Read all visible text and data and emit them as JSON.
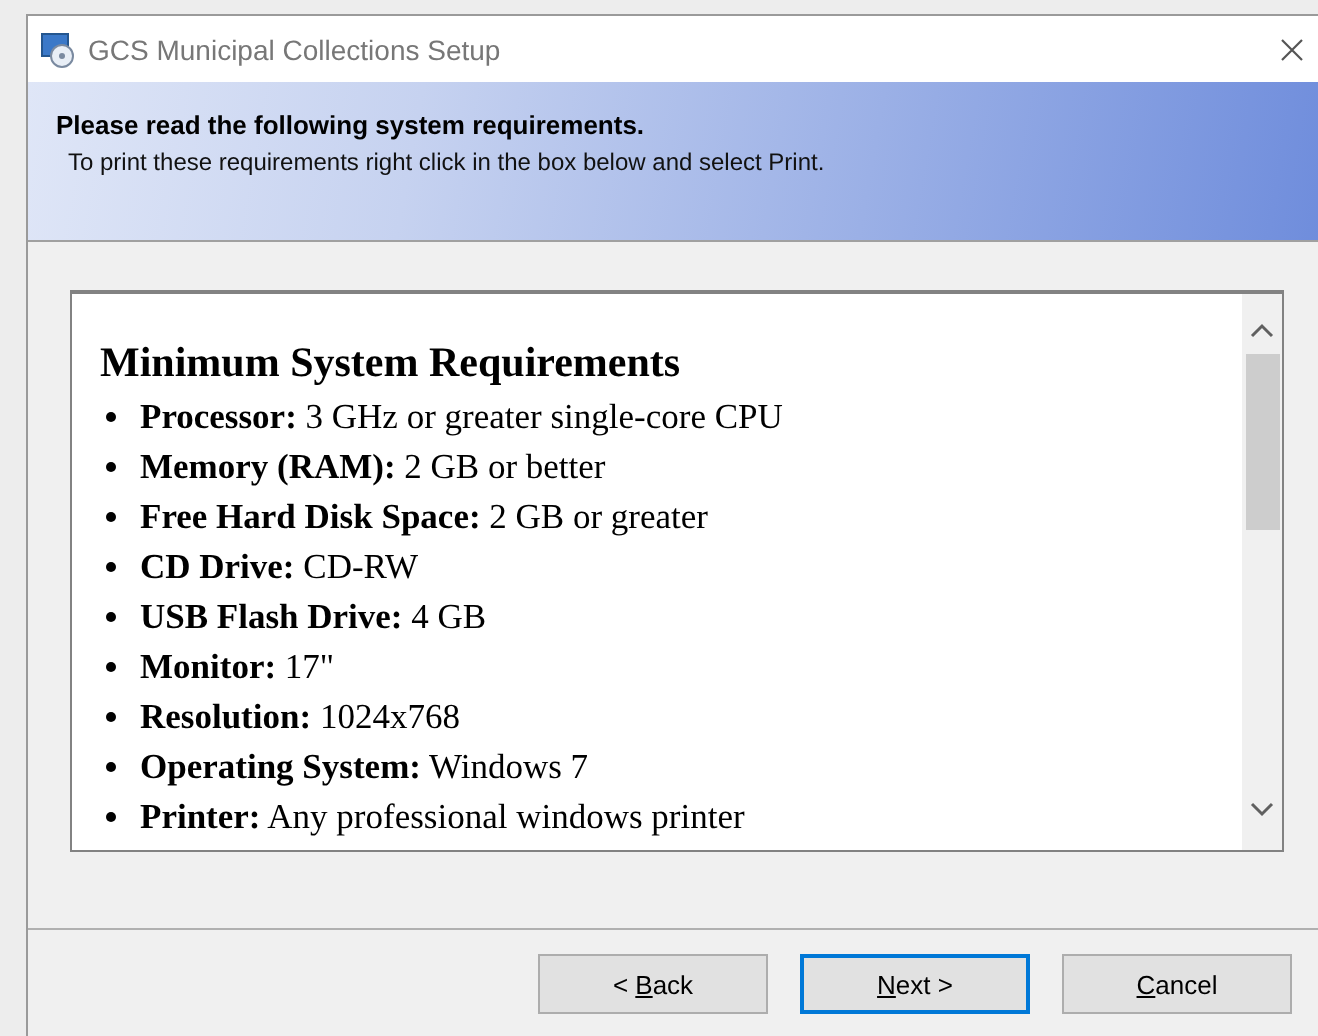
{
  "window": {
    "title": "GCS Municipal Collections Setup"
  },
  "banner": {
    "heading": "Please read the following system requirements.",
    "subtext": "To print these requirements right click in the box below and select Print."
  },
  "requirements": {
    "heading": "Minimum System Requirements",
    "items": [
      {
        "label": "Processor:",
        "value": "3 GHz or greater single-core CPU"
      },
      {
        "label": "Memory (RAM):",
        "value": "2 GB or better"
      },
      {
        "label": "Free Hard Disk Space:",
        "value": "2 GB or greater"
      },
      {
        "label": "CD Drive:",
        "value": "CD-RW"
      },
      {
        "label": "USB Flash Drive:",
        "value": "4 GB"
      },
      {
        "label": "Monitor:",
        "value": "17\""
      },
      {
        "label": "Resolution:",
        "value": "1024x768"
      },
      {
        "label": "Operating System:",
        "value": "Windows 7"
      },
      {
        "label": "Printer:",
        "value": "Any professional windows printer"
      }
    ]
  },
  "buttons": [
    {
      "label_before": "< ",
      "access_key": "B",
      "label_after": "ack",
      "focused": false
    },
    {
      "access_key": "N",
      "label_after": "ext >",
      "focused": true
    },
    {
      "access_key": "C",
      "label_after": "ancel",
      "focused": false
    }
  ]
}
